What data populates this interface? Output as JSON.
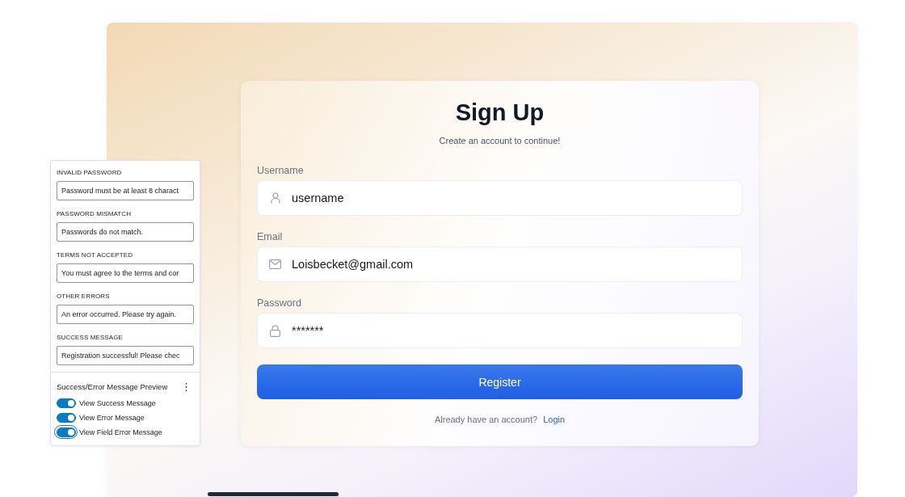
{
  "signup": {
    "title": "Sign Up",
    "subtitle": "Create an account to continue!",
    "fields": [
      {
        "kind": "user",
        "label": "Username",
        "value": "username"
      },
      {
        "kind": "mail",
        "label": "Email",
        "value": "Loisbecket@gmail.com"
      },
      {
        "kind": "lock",
        "label": "Password",
        "value": "*******"
      }
    ],
    "button": "Register",
    "footer": {
      "text": "Already have an account?",
      "link": "Login"
    }
  },
  "settings_panel": {
    "messages": [
      {
        "label": "INVALID PASSWORD",
        "value": "Password must be at least 8 charact"
      },
      {
        "label": "PASSWORD MISMATCH",
        "value": "Passwords do not match."
      },
      {
        "label": "TERMS NOT ACCEPTED",
        "value": "You must agree to the terms and cor"
      },
      {
        "label": "OTHER ERRORS",
        "value": "An error occurred. Please try again."
      },
      {
        "label": "SUCCESS MESSAGE",
        "value": "Registration successful! Please chec"
      }
    ],
    "preview": {
      "title": "Success/Error Message Preview",
      "menu": "⋮",
      "toggles": [
        {
          "label": "View Success Message",
          "on": true,
          "focused": false
        },
        {
          "label": "View Error Message",
          "on": true,
          "focused": false
        },
        {
          "label": "View Field Error Message",
          "on": true,
          "focused": true
        }
      ]
    }
  }
}
